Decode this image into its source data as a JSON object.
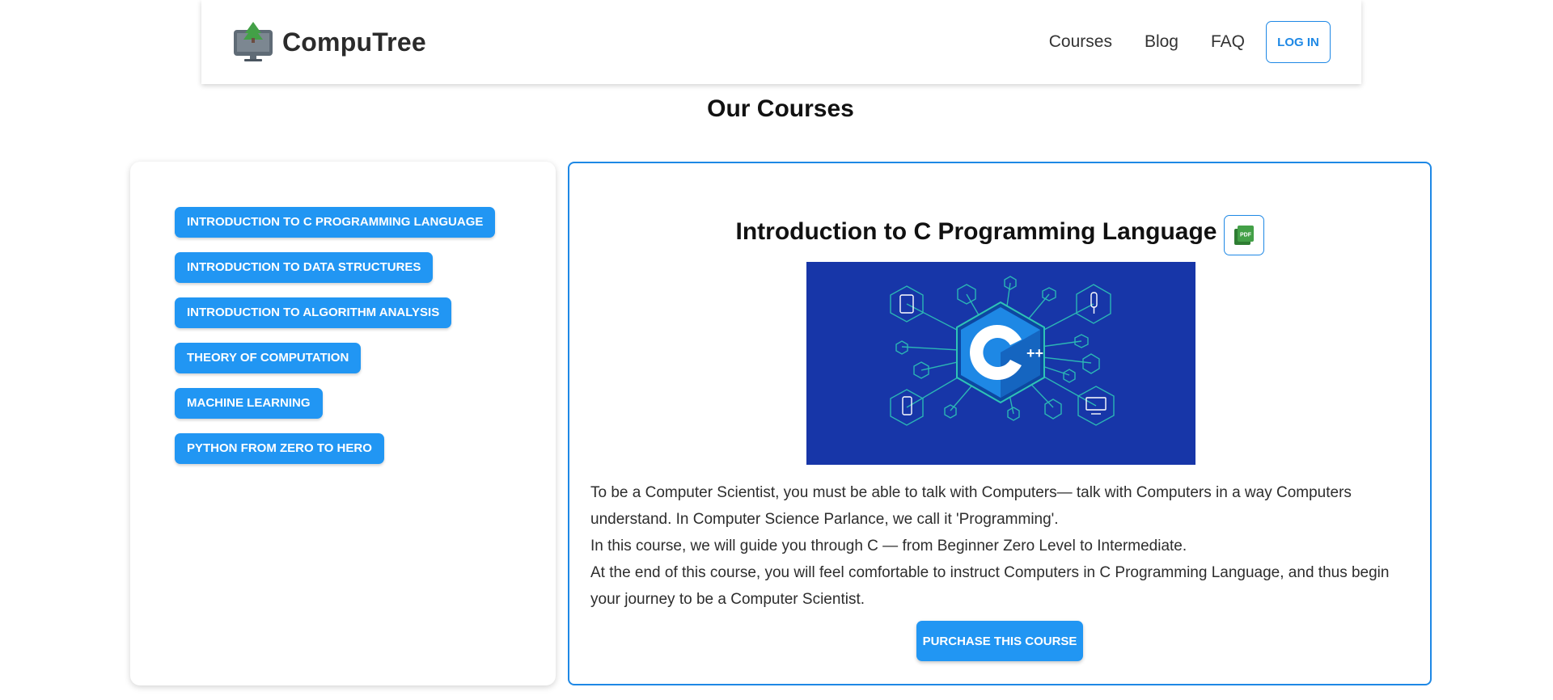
{
  "header": {
    "brand_name": "CompuTree",
    "logo_icon": "computer-tree-icon",
    "nav": [
      "Courses",
      "Blog",
      "FAQ"
    ],
    "login_label": "LOG IN"
  },
  "page": {
    "title": "Our Courses"
  },
  "courses": [
    "INTRODUCTION TO C PROGRAMMING LANGUAGE",
    "INTRODUCTION TO DATA STRUCTURES",
    "INTRODUCTION TO ALGORITHM ANALYSIS",
    "THEORY OF COMPUTATION",
    "MACHINE LEARNING",
    "PYTHON FROM ZERO TO HERO"
  ],
  "detail": {
    "title": "Introduction to C Programming Language",
    "pdf_icon": "pdf-icon",
    "image_icon": "cpp-logo-icon",
    "paragraphs": [
      "To be a Computer Scientist, you must be able to talk with Computers— talk with Computers in a way Computers understand. In Computer Science Parlance, we call it 'Programming'.",
      "In this course, we will guide you through C — from Beginner Zero Level to Intermediate.",
      "At the end of this course, you will feel comfortable to instruct Computers in C Programming Language, and thus begin your journey to be a Computer Scientist."
    ],
    "purchase_label": "PURCHASE THIS COURSE"
  },
  "colors": {
    "accent": "#2196f3",
    "border": "#1e88e5",
    "image_bg": "#1736a8",
    "logo_green": "#43a047"
  }
}
